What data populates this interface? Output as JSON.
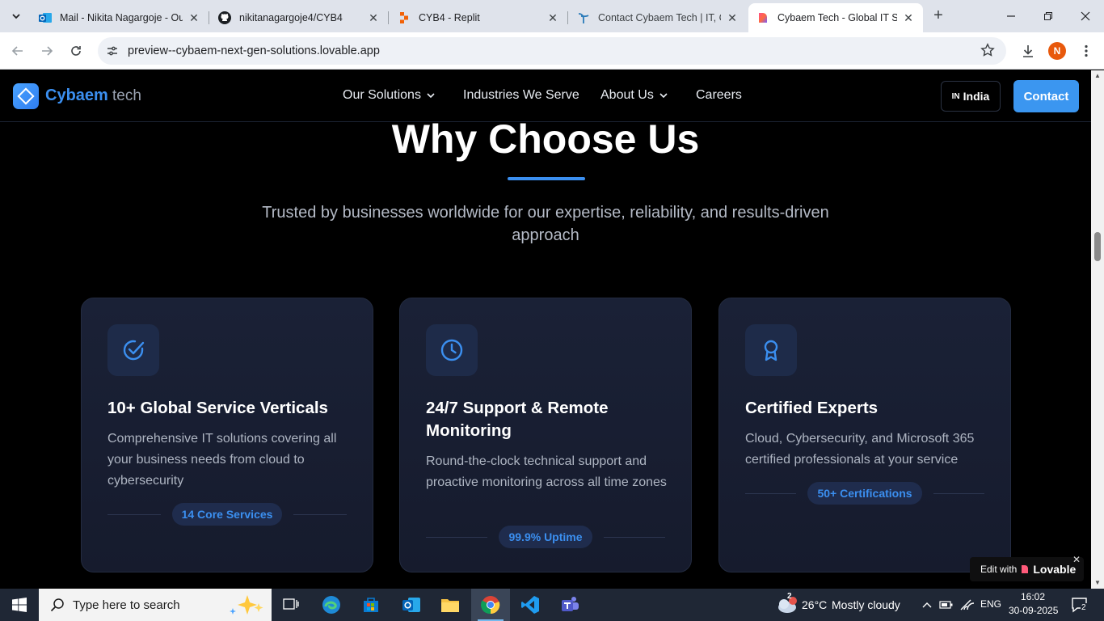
{
  "browser": {
    "tabs": [
      {
        "title": "Mail - Nikita Nagargoje - Ou",
        "icon": "outlook-icon",
        "active": false
      },
      {
        "title": "nikitanagargoje4/CYB4",
        "icon": "github-icon",
        "active": false
      },
      {
        "title": "CYB4 - Replit",
        "icon": "replit-icon",
        "active": false
      },
      {
        "title": "Contact Cybaem Tech | IT, Cl",
        "icon": "cybaem-icon",
        "active": false
      },
      {
        "title": "Cybaem Tech - Global IT Solu",
        "icon": "lovable-icon",
        "active": true
      }
    ],
    "url": "preview--cybaem-next-gen-solutions.lovable.app",
    "profile_initial": "N"
  },
  "site": {
    "logo": {
      "name": "Cybaem",
      "suffix": "tech"
    },
    "nav": [
      {
        "label": "Our Solutions",
        "has_dropdown": true
      },
      {
        "label": "Industries We Serve",
        "has_dropdown": false
      },
      {
        "label": "About Us",
        "has_dropdown": true
      },
      {
        "label": "Careers",
        "has_dropdown": false
      }
    ],
    "country": {
      "code": "IN",
      "label": "India"
    },
    "contact_label": "Contact"
  },
  "section": {
    "title": "Why Choose Us",
    "subtitle": "Trusted by businesses worldwide for our expertise, reliability, and results-driven approach",
    "cards": [
      {
        "icon": "check-circle-icon",
        "title": "10+ Global Service Verticals",
        "description": "Comprehensive IT solutions covering all your business needs from cloud to cybersecurity",
        "badge": "14 Core Services"
      },
      {
        "icon": "clock-icon",
        "title": "24/7 Support & Remote Monitoring",
        "description": "Round-the-clock technical support and proactive monitoring across all time zones",
        "badge": "99.9% Uptime"
      },
      {
        "icon": "award-icon",
        "title": "Certified Experts",
        "description": "Cloud, Cybersecurity, and Microsoft 365 certified professionals at your service",
        "badge": "50+ Certifications"
      }
    ]
  },
  "lovable_badge": {
    "prefix": "Edit with",
    "brand": "Lovable"
  },
  "taskbar": {
    "search_placeholder": "Type here to search",
    "weather": {
      "temp": "26°C",
      "condition": "Mostly cloudy",
      "alerts": "2"
    },
    "language": "ENG",
    "time": "16:02",
    "date": "30-09-2025",
    "notifications": "2"
  },
  "colors": {
    "accent": "#3b8ff0",
    "card_bg": "#181e31",
    "page_bg": "#000000"
  }
}
